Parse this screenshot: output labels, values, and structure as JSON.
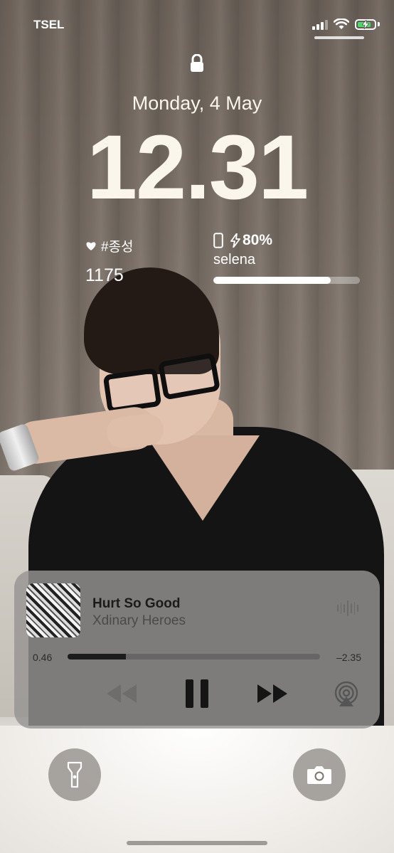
{
  "status_bar": {
    "carrier": "TSEL",
    "signal_bars": 3,
    "wifi": "wifi-icon",
    "battery_charging": true,
    "battery_color": "#4cd964"
  },
  "lock_screen": {
    "date": "Monday, 4 May",
    "time": "12.31",
    "lock_icon": "lock-icon"
  },
  "widgets": {
    "left": {
      "icon": "heart-icon",
      "label": "#종성",
      "count": "1175"
    },
    "right": {
      "icon": "phone-icon",
      "battery_text": "80%",
      "bolt_icon": "bolt-icon",
      "name": "selena",
      "battery_level": 0.8
    }
  },
  "now_playing": {
    "title": "Hurt So Good",
    "artist": "Xdinary Heroes",
    "elapsed": "0.46",
    "remaining": "–2.35",
    "progress": 0.23,
    "controls": {
      "rewind_icon": "rewind-icon",
      "pause_icon": "pause-icon",
      "forward_icon": "fast-forward-icon",
      "airplay_icon": "airplay-icon",
      "waveform_icon": "waveform-icon"
    }
  },
  "bottom_actions": {
    "left": "flashlight-icon",
    "right": "camera-icon"
  }
}
